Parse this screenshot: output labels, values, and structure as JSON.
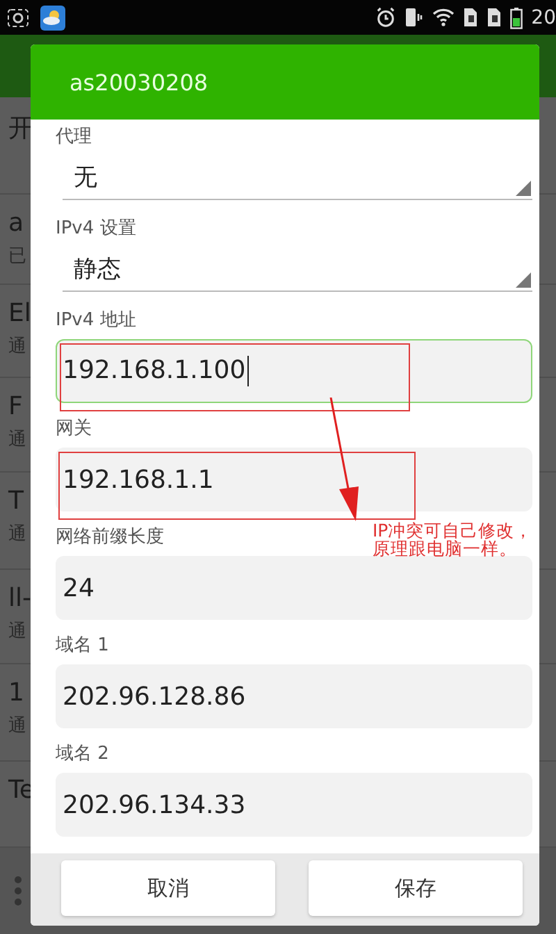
{
  "status_bar": {
    "time": "20"
  },
  "background_list": {
    "items": [
      {
        "title": "开"
      },
      {
        "title": "a",
        "subtitle": "已"
      },
      {
        "title": "El",
        "subtitle": "通"
      },
      {
        "title": "F",
        "subtitle": "通"
      },
      {
        "title": "T",
        "subtitle": "通"
      },
      {
        "title": "ll-",
        "subtitle": "通"
      },
      {
        "title": "1",
        "subtitle": "通"
      },
      {
        "title": "Te"
      }
    ]
  },
  "dialog": {
    "title": "as20030208",
    "fields": [
      {
        "kind": "dropdown",
        "label": "代理",
        "value": "无"
      },
      {
        "kind": "dropdown",
        "label": "IPv4 设置",
        "value": "静态"
      },
      {
        "kind": "text",
        "label": "IPv4 地址",
        "value": "192.168.1.100",
        "focused": true
      },
      {
        "kind": "text",
        "label": "网关",
        "value": "192.168.1.1",
        "focused": false
      },
      {
        "kind": "text",
        "label": "网络前缀长度",
        "value": "24",
        "focused": false
      },
      {
        "kind": "text",
        "label": "域名 1",
        "value": "202.96.128.86",
        "focused": false
      },
      {
        "kind": "text",
        "label": "域名 2",
        "value": "202.96.134.33",
        "focused": false
      }
    ],
    "buttons": [
      "取消",
      "保存"
    ]
  },
  "annotation": {
    "note": "IP冲突可自己修改，原理跟电脑一样。"
  }
}
